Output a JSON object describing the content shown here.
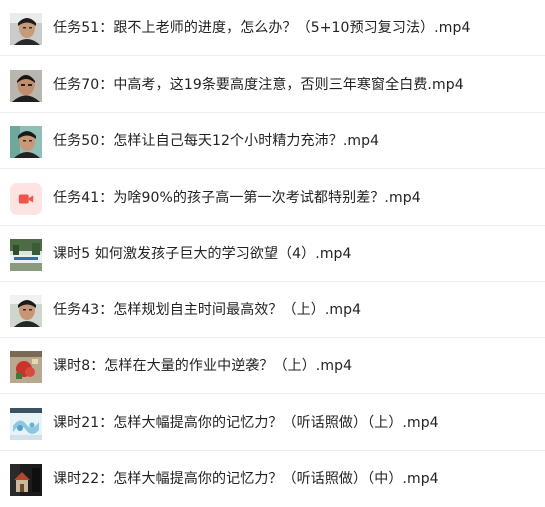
{
  "files": [
    {
      "name": "任务51：跟不上老师的进度，怎么办？（5+10预习复习法）.mp4",
      "thumb": "person",
      "icon": "person-thumbnail-icon"
    },
    {
      "name": "任务70：中高考，这19条要高度注意，否则三年寒窗全白费.mp4",
      "thumb": "person",
      "icon": "person-thumbnail-icon"
    },
    {
      "name": "任务50：怎样让自己每天12个小时精力充沛？.mp4",
      "thumb": "person",
      "icon": "person-thumbnail-icon"
    },
    {
      "name": "任务41：为啥90%的孩子高一第一次考试都特别差？.mp4",
      "thumb": "video",
      "icon": "video-file-icon"
    },
    {
      "name": "课时5 如何激发孩子巨大的学习欲望（4）.mp4",
      "thumb": "landscape",
      "icon": "landscape-thumbnail-icon"
    },
    {
      "name": "任务43：怎样规划自主时间最高效？（上）.mp4",
      "thumb": "person",
      "icon": "person-thumbnail-icon"
    },
    {
      "name": "课时8：怎样在大量的作业中逆袭？（上）.mp4",
      "thumb": "red-object",
      "icon": "image-thumbnail-icon"
    },
    {
      "name": "课时21：怎样大幅提高你的记忆力？（听话照做）（上）.mp4",
      "thumb": "splash",
      "icon": "image-thumbnail-icon"
    },
    {
      "name": "课时22：怎样大幅提高你的记忆力？（听话照做）（中）.mp4",
      "thumb": "dark-house",
      "icon": "image-thumbnail-icon"
    }
  ],
  "colors": {
    "video_icon_bg": "#fde3e1",
    "video_icon_fg": "#f0554b",
    "divider": "#ececec",
    "text": "#222222"
  }
}
